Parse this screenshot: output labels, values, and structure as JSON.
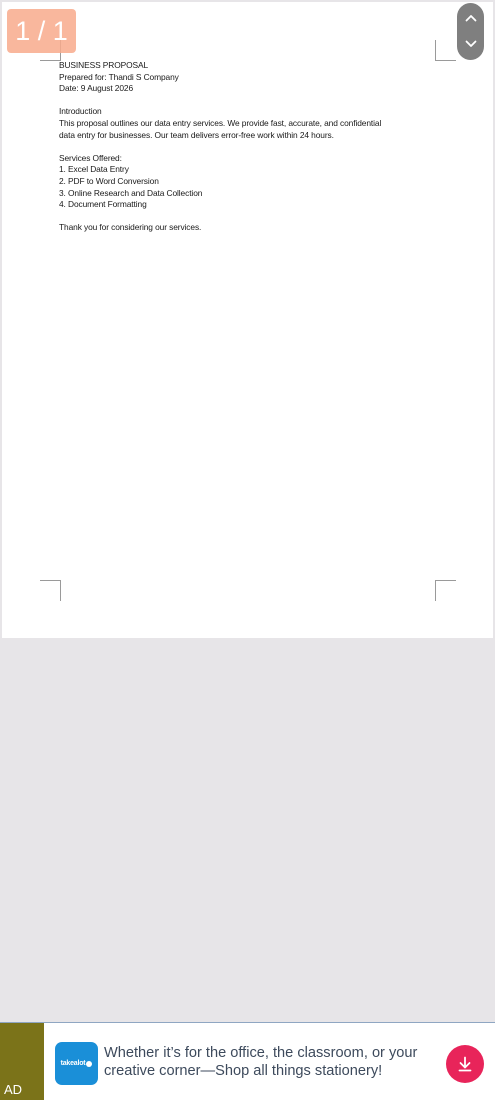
{
  "viewer": {
    "page_counter": "1 / 1",
    "nav": {
      "up_icon": "chevron-up-icon",
      "down_icon": "chevron-down-icon"
    }
  },
  "document": {
    "lines_block1": [
      "BUSINESS PROPOSAL",
      "Prepared for: Thandi S Company",
      "Date: 9 August 2026"
    ],
    "lines_block2": [
      "Introduction",
      "This proposal outlines our data entry services. We provide fast, accurate, and confidential",
      "data entry for businesses. Our team delivers error-free work within 24 hours."
    ],
    "lines_block3": [
      "Services Offered:",
      "1. Excel Data Entry",
      "2. PDF to Word Conversion",
      "3. Online Research and Data Collection",
      "4. Document Formatting"
    ],
    "lines_block4": [
      "Thank you for considering our services."
    ]
  },
  "ad": {
    "label": "AD",
    "logo_text": "takealot",
    "message": "Whether it’s for the office, the classroom, or your creative corner—Shop all things stationery!",
    "download_icon": "download-icon",
    "colors": {
      "label_bg": "#7b7319",
      "logo_bg": "#1a8fd8",
      "download_bg": "#e8245a"
    }
  }
}
